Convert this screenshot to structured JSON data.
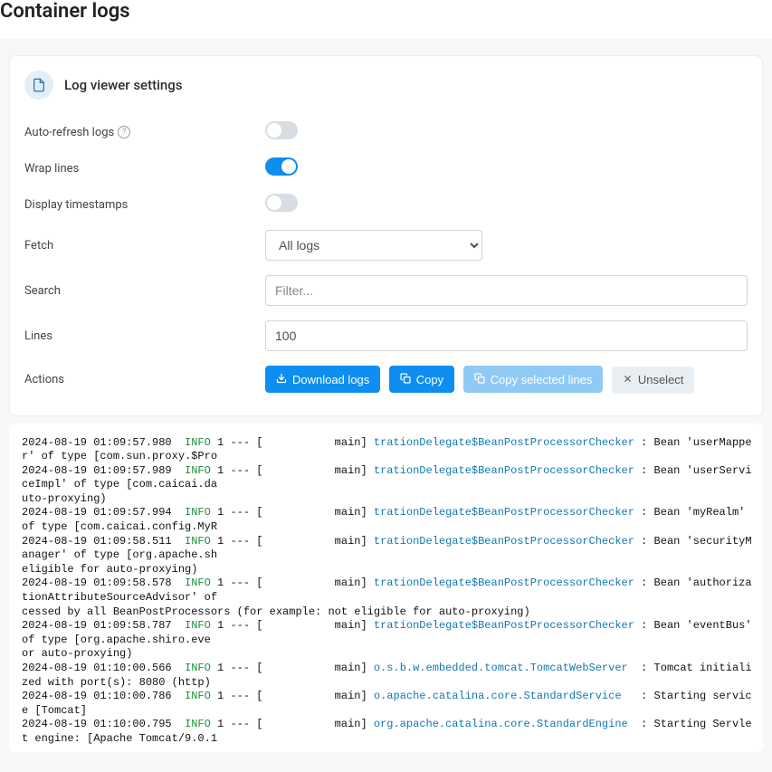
{
  "title": "Container logs",
  "panel": {
    "header": "Log viewer settings",
    "rows": {
      "autoRefresh": {
        "label": "Auto-refresh logs",
        "on": false
      },
      "wrapLines": {
        "label": "Wrap lines",
        "on": true
      },
      "timestamps": {
        "label": "Display timestamps",
        "on": false
      },
      "fetch": {
        "label": "Fetch",
        "value": "All logs",
        "options": [
          "All logs"
        ]
      },
      "search": {
        "label": "Search",
        "placeholder": "Filter..."
      },
      "lines": {
        "label": "Lines",
        "value": "100"
      },
      "actions": {
        "label": "Actions",
        "download": "Download logs",
        "copy": "Copy",
        "copySelected": "Copy selected lines",
        "unselect": "Unselect"
      }
    }
  },
  "logs": [
    {
      "ts": "2024-08-19 01:09:57.980",
      "level": "INFO",
      "pid": "1",
      "thread": "main",
      "logger": "trationDelegate$BeanPostProcessorChecker",
      "msg": " : Bean 'userMapper' of type [com.sun.proxy.$Pro",
      "cont": ""
    },
    {
      "ts": "2024-08-19 01:09:57.989",
      "level": "INFO",
      "pid": "1",
      "thread": "main",
      "logger": "trationDelegate$BeanPostProcessorChecker",
      "msg": " : Bean 'userServiceImpl' of type [com.caicai.da",
      "cont": "uto-proxying)"
    },
    {
      "ts": "2024-08-19 01:09:57.994",
      "level": "INFO",
      "pid": "1",
      "thread": "main",
      "logger": "trationDelegate$BeanPostProcessorChecker",
      "msg": " : Bean 'myRealm' of type [com.caicai.config.MyR",
      "cont": ""
    },
    {
      "ts": "2024-08-19 01:09:58.511",
      "level": "INFO",
      "pid": "1",
      "thread": "main",
      "logger": "trationDelegate$BeanPostProcessorChecker",
      "msg": " : Bean 'securityManager' of type [org.apache.sh",
      "cont": "eligible for auto-proxying)"
    },
    {
      "ts": "2024-08-19 01:09:58.578",
      "level": "INFO",
      "pid": "1",
      "thread": "main",
      "logger": "trationDelegate$BeanPostProcessorChecker",
      "msg": " : Bean 'authorizationAttributeSourceAdvisor' of",
      "cont": "cessed by all BeanPostProcessors (for example: not eligible for auto-proxying)"
    },
    {
      "ts": "2024-08-19 01:09:58.787",
      "level": "INFO",
      "pid": "1",
      "thread": "main",
      "logger": "trationDelegate$BeanPostProcessorChecker",
      "msg": " : Bean 'eventBus' of type [org.apache.shiro.eve",
      "cont": "or auto-proxying)"
    },
    {
      "ts": "2024-08-19 01:10:00.566",
      "level": "INFO",
      "pid": "1",
      "thread": "main",
      "logger": "o.s.b.w.embedded.tomcat.TomcatWebServer ",
      "msg": " : Tomcat initialized with port(s): 8080 (http) ",
      "cont": ""
    },
    {
      "ts": "2024-08-19 01:10:00.786",
      "level": "INFO",
      "pid": "1",
      "thread": "main",
      "logger": "o.apache.catalina.core.StandardService  ",
      "msg": " : Starting service [Tomcat]",
      "cont": ""
    },
    {
      "ts": "2024-08-19 01:10:00.795",
      "level": "INFO",
      "pid": "1",
      "thread": "main",
      "logger": "org.apache.catalina.core.StandardEngine ",
      "msg": " : Starting Servlet engine: [Apache Tomcat/9.0.1",
      "cont": ""
    }
  ]
}
